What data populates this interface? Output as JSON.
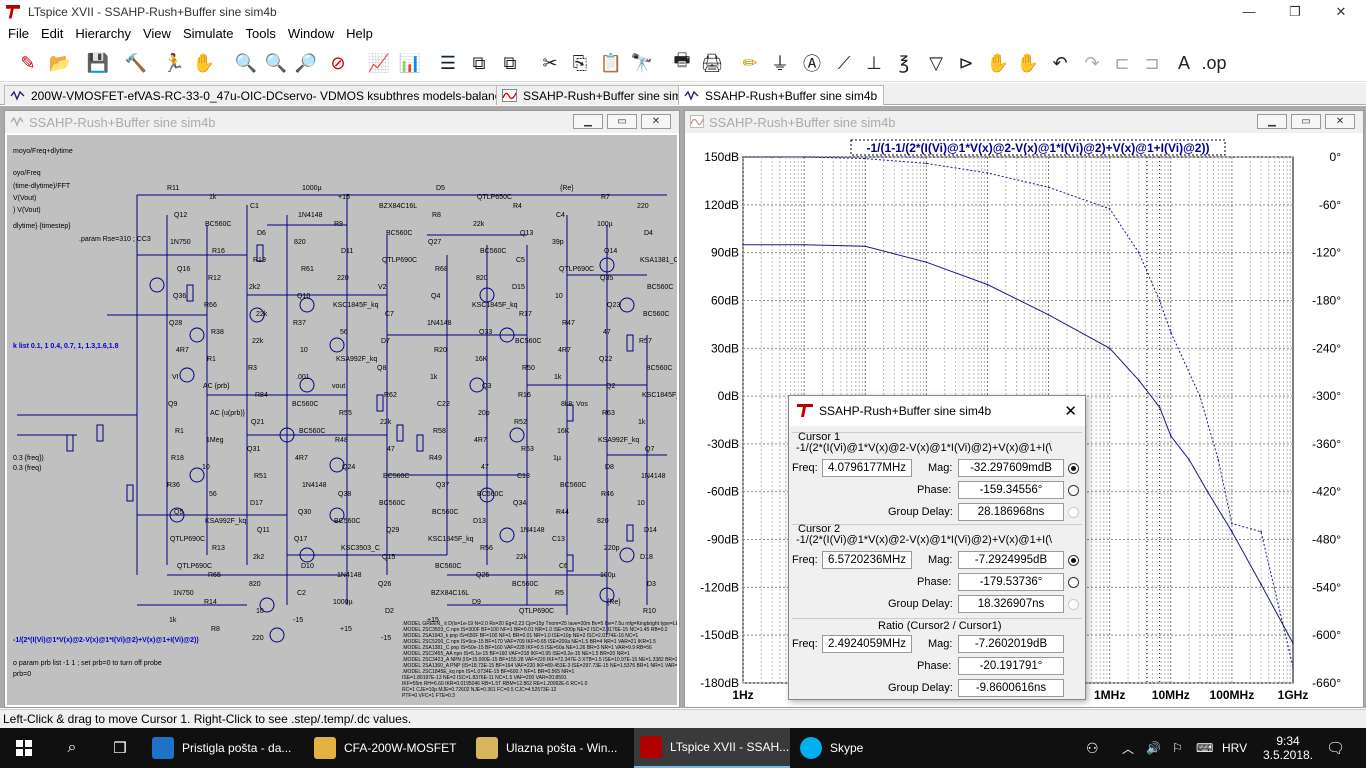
{
  "window": {
    "title": "LTspice XVII - SSAHP-Rush+Buffer sine sim4b",
    "controls": [
      "—",
      "❐",
      "✕"
    ]
  },
  "menu": [
    "File",
    "Edit",
    "Hierarchy",
    "View",
    "Simulate",
    "Tools",
    "Window",
    "Help"
  ],
  "tabs": [
    {
      "label": "200W-VMOSFET-efVAS-RC-33-0_47u-OIC-DCservo- VDMOS ksubthres models-balanced-inputs",
      "kind": "schematic"
    },
    {
      "label": "SSAHP-Rush+Buffer sine sim4b",
      "kind": "schematic"
    },
    {
      "label": "SSAHP-Rush+Buffer sine sim4b",
      "kind": "waveform",
      "active": true
    }
  ],
  "left_pane": {
    "title": "SSAHP-Rush+Buffer sine sim4b",
    "left_text": [
      "moyo/Freq+dlytime",
      "oyo/Freq",
      "(time-dlytime)/FFT",
      "V(Vout)",
      ") V(Vout)",
      "dlytime} {timestep}",
      "k list 0.1, 1 0.4, 0.7, 1, 1.3,1.6,1.8",
      "0.3 {freq})",
      "0.3 (freq)",
      "-1/(2*(I(Vi)@1*V(x)@2-V(x)@1*I(Vi)@2)+V(x)@1+I(Vi)@2))",
      "o param prb list -1 1 ; set prb=0 to turn off probe",
      "prb=0"
    ],
    "param": ".param Rse=310 ; CC3",
    "labels": [
      "R11",
      "1k",
      "C1",
      "1000µ",
      "+15",
      "BZX84C16L",
      "D5",
      "QTLP650C",
      "R4",
      "{Re}",
      "R7",
      "220",
      "Q12",
      "BC560C",
      "D6",
      "1N4148",
      "R9",
      "BC560C",
      "R8",
      "22k",
      "Q13",
      "C4",
      "100µ",
      "D4",
      "1N750",
      "R16",
      "R19",
      "820",
      "D11",
      "QTLP690C",
      "Q27",
      "BC560C",
      "C5",
      "39p",
      "Q14",
      "KSA1381_C",
      "Q16",
      "R12",
      "2k2",
      "R61",
      "220",
      "V2",
      "R68",
      "820",
      "D15",
      "QTLP690C",
      "Q35",
      "BC560C",
      "Q36",
      "R66",
      "22k",
      "Q10",
      "KSC1845F_kq",
      "C7",
      "Q4",
      "KSC1845F_kq",
      "R17",
      "10",
      "Q23",
      "BC560C",
      "Q28",
      "R38",
      "22k",
      "R37",
      "56",
      "D7",
      "1N4148",
      "Q33",
      "BC560C",
      "R47",
      "47",
      "R57",
      "4R7",
      "R1",
      "R3",
      "10",
      "KSA992F_kq",
      "Q8",
      "R20",
      "16K",
      "R50",
      "4R7",
      "Q22",
      "BC560C",
      "VI",
      "AC {prb}",
      "R84",
      ".001",
      "vout",
      "R62",
      "1k",
      "Q3",
      "R16",
      "1k",
      "Q2",
      "KSC1845F_kq",
      "Q9",
      "AC {u(prb)}",
      "Q21",
      "BC560C",
      "R55",
      "22k",
      "C22",
      "20p",
      "R52",
      "8k8; Vos",
      "R63",
      "1k",
      "R1",
      "1Meg",
      "Q31",
      "BC560C",
      "R48",
      "47",
      "R58",
      "4R7",
      "R63",
      "16K",
      "KSA992F_kq",
      "Q7",
      "R18",
      "10",
      "R51",
      "4R7",
      "Q24",
      "BC560C",
      "R49",
      "47",
      "C18",
      "1µ",
      "D8",
      "1N4148",
      "R36",
      "56",
      "D17",
      "1N4148",
      "Q38",
      "BC560C",
      "Q37",
      "BC560C",
      "Q34",
      "BC560C",
      "R46",
      "10",
      "Q5",
      "KSA992F_kq",
      "Q11",
      "Q30",
      "BC560C",
      "Q29",
      "BC560C",
      "D13",
      "1N4148",
      "R44",
      "820",
      "D14",
      "QTLP690C",
      "R13",
      "2k2",
      "Q17",
      "KSC3503_C",
      "Q15",
      "KSC1845F_kq",
      "R56",
      "22k",
      "C13",
      "220p",
      "D18",
      "QTLP690C",
      "R65",
      "820",
      "D10",
      "1N4148",
      "Q26",
      "BC560C",
      "Q25",
      "BC560C",
      "C6",
      "100µ",
      "D3",
      "1N750",
      "R14",
      "10",
      "C2",
      "1000µ",
      "D2",
      "BZX84C16L",
      "D9",
      "QTLP690C",
      "R5",
      "{Re}",
      "R10",
      "1k",
      "R8",
      "220",
      "-15",
      "+15",
      "-15",
      "+15"
    ],
    "models_text": [
      ".MODEL GREEN_ it D(Is=1e-19 N=2.0 Rs=20 Eg=2.23 Cjo=15p Tnom=25 Iave=20m Bv=5 Ibv=7.5u mfg=Kingbright type=LED)",
      ".MODEL 2SC3503_C npn IS=300F BF=100 NF=1 BR=0.01 NR=1.0 ISE=300p NE=2 ISC=2.9176E-15 NC=1.45 RB=0.2",
      ".MODEL 2SA1943_k pnp IS=650F BF=100 NF=1 BR=0.01 NR=1.0 ISE=10p NE=2 ISC=2.0174E-16 NC=1",
      ".MODEL 2SC5200_C npn IS=9ce-15 BF=170 VAF=709 IKF=0.65 ISE=200a NE=1.5 BR=4 NR=1 VAR=21 IKR=1.5",
      ".MODEL 2SA1381_C pnp IS=50e-15 BF=160 VAF=228 IKF=0.5 ISE=50a NE=1.26 BR=3 NR=1 VAR=9.9 RB=56",
      ".MODEL 2SC2455_AA npn IS=5.1e-15 BF=160 VAF=218 IKF=0.95 ISE=9.2e-15 NE=1.5 BR=20 NR=1",
      ".MODEL 2SC3423_A NPN (IS=15.000E-15 BF=155.28 VAF=220 IKF=72.347E-3 XTB=1.5 ISE=10.97E-15 NE=1.3382 BR=2.2 NR=1",
      ".MODEL 2SA1360_A PNP (IS=18.73E-15 BF=164 VAF=220 IKF=89.453E-3 ISE=297.73E-15 NE=1.5376 BR=1 NR=1 VAR=100",
      ".MODEL 2SC1845E_kq npn IS=1.0734E-15 BF=600.7 NF=1 BR=0.565 NR=1",
      "ISE=1.80197E-13 NE=2 ISC=1.8376E-11 NC=1.5 VAF=200 VAR=20.8591",
      "IKF=55m RH=6.60 IKR=0.0195046 RB=1.5T RBM=12.862 RE=1.20992E-6 RC=1.0",
      "RC=1 CJE=10p MJE=0.72602 NJE=0.361 FC=0.5 CJC=4.52573E-12",
      "PTF=0 VFC=1 FTE=0.3"
    ]
  },
  "plot": {
    "title": "SSAHP-Rush+Buffer sine sim4b",
    "trace_expr": "-1/(1-1/(2*(I(Vi)@1*V(x)@2-V(x)@1*I(Vi)@2)+V(x)@1+I(Vi)@2))"
  },
  "chart_data": {
    "type": "line",
    "title": "-1/(1-1/(2*(I(Vi)@1*V(x)@2-V(x)@1*I(Vi)@2)+V(x)@1+I(Vi)@2))",
    "xscale": "log",
    "xlim": [
      1,
      1000000000
    ],
    "x_ticks": [
      "1Hz",
      "1MHz",
      "10MHz",
      "100MHz",
      "1GHz"
    ],
    "y_left_label": "magnitude",
    "y_left_ticks": [
      "150dB",
      "120dB",
      "90dB",
      "60dB",
      "30dB",
      "0dB",
      "-30dB",
      "-60dB",
      "-90dB",
      "-120dB",
      "-150dB",
      "-180dB"
    ],
    "ylim_left": [
      -180,
      150
    ],
    "y_right_ticks": [
      "0°",
      "-60°",
      "-120°",
      "-180°",
      "-240°",
      "-300°",
      "-360°",
      "-420°",
      "-480°",
      "-540°",
      "-600°",
      "-660°"
    ],
    "ylim_right": [
      -660,
      0
    ],
    "grid": true,
    "series": [
      {
        "name": "magnitude",
        "style": "solid",
        "x": [
          1,
          10,
          100,
          1000,
          10000,
          100000,
          1000000,
          3000000,
          6572023,
          10000000,
          20000000,
          40000000,
          100000000,
          300000000,
          1000000000
        ],
        "y": [
          95,
          95,
          94,
          84,
          70,
          51,
          30,
          10,
          -7,
          -25,
          -40,
          -60,
          -85,
          -118,
          -155
        ]
      },
      {
        "name": "phase",
        "style": "dashed",
        "x": [
          1,
          10,
          100,
          1000,
          10000,
          100000,
          1000000,
          3000000,
          6572023,
          10000000,
          30000000,
          60000000,
          100000000,
          300000000,
          1000000000
        ],
        "y": [
          0,
          0,
          -2,
          -8,
          -20,
          -38,
          -65,
          -120,
          -180,
          -220,
          -300,
          -380,
          -460,
          -470,
          -640
        ]
      }
    ]
  },
  "cursor_dialog": {
    "title": "SSAHP-Rush+Buffer sine sim4b",
    "cursor1": {
      "header": "Cursor 1",
      "expr": "-1/(2*(I(Vi)@1*V(x)@2-V(x)@1*I(Vi)@2)+V(x)@1+I(\\",
      "freq_label": "Freq:",
      "freq": "4.0796177MHz",
      "mag_label": "Mag:",
      "mag": "-32.297609mdB",
      "phase_label": "Phase:",
      "phase": "-159.34556°",
      "gd_label": "Group Delay:",
      "gd": "28.186968ns"
    },
    "cursor2": {
      "header": "Cursor 2",
      "expr": "-1/(2*(I(Vi)@1*V(x)@2-V(x)@1*I(Vi)@2)+V(x)@1+I(\\",
      "freq_label": "Freq:",
      "freq": "6.5720236MHz",
      "mag_label": "Mag:",
      "mag": "-7.2924995dB",
      "phase_label": "Phase:",
      "phase": "-179.53736°",
      "gd_label": "Group Delay:",
      "gd": "18.326907ns"
    },
    "ratio": {
      "header": "Ratio (Cursor2 / Cursor1)",
      "freq_label": "Freq:",
      "freq": "2.4924059MHz",
      "mag_label": "Mag:",
      "mag": "-7.2602019dB",
      "phase_label": "Phase:",
      "phase": "-20.191791°",
      "gd_label": "Group Delay:",
      "gd": "-9.8600616ns"
    }
  },
  "status": "Left-Click & drag to move Cursor 1.  Right-Click to see .step/.temp/.dc values.",
  "taskbar": {
    "items": [
      {
        "label": "Pristigla pošta - da...",
        "color": "#1e73c8"
      },
      {
        "label": "CFA-200W-MOSFET",
        "color": "#e3b341"
      },
      {
        "label": "Ulazna pošta - Win...",
        "color": "#d9b65c"
      },
      {
        "label": "LTspice XVII - SSAH...",
        "color": "#b00000",
        "active": true
      },
      {
        "label": "Skype",
        "color": "#00aff0"
      }
    ],
    "lang": "HRV",
    "time": "9:34",
    "date": "3.5.2018."
  }
}
